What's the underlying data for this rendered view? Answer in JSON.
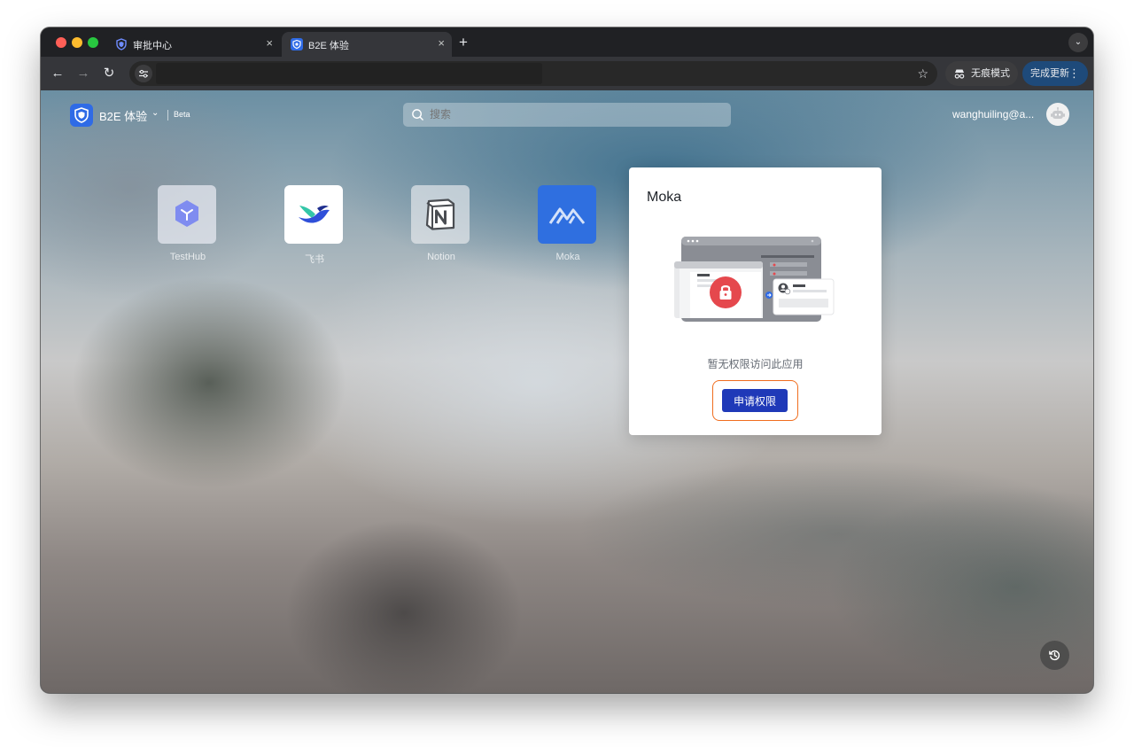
{
  "browser": {
    "tabs": [
      {
        "title": "审批中心",
        "active": false
      },
      {
        "title": "B2E 体验",
        "active": true
      }
    ],
    "new_tab_symbol": "+",
    "close_symbol": "×",
    "tab_dropdown_symbol": "⌄",
    "nav": {
      "back": "←",
      "forward": "→",
      "reload": "↻"
    },
    "bookmark_symbol": "☆",
    "incognito_label": "无痕模式",
    "update_label": "完成更新",
    "menu_symbol": "⋮"
  },
  "header": {
    "brand_name": "B2E 体验",
    "brand_caret": "⌄",
    "beta_label": "Beta",
    "search_placeholder": "搜索",
    "user_email": "wanghuiling@a..."
  },
  "apps": [
    {
      "name": "TestHub",
      "icon": "cube-icon"
    },
    {
      "name": "飞书",
      "icon": "feishu-bird-icon"
    },
    {
      "name": "Notion",
      "icon": "notion-n-icon"
    },
    {
      "name": "Moka",
      "icon": "moka-mountain-icon"
    }
  ],
  "dialog": {
    "title": "Moka",
    "message": "暂无权限访问此应用",
    "button_label": "申请权限"
  },
  "colors": {
    "brand_blue": "#2f6be6",
    "primary_button": "#1f39b8",
    "focus_outline": "#f06d1e",
    "lock_red": "#e5484d"
  }
}
